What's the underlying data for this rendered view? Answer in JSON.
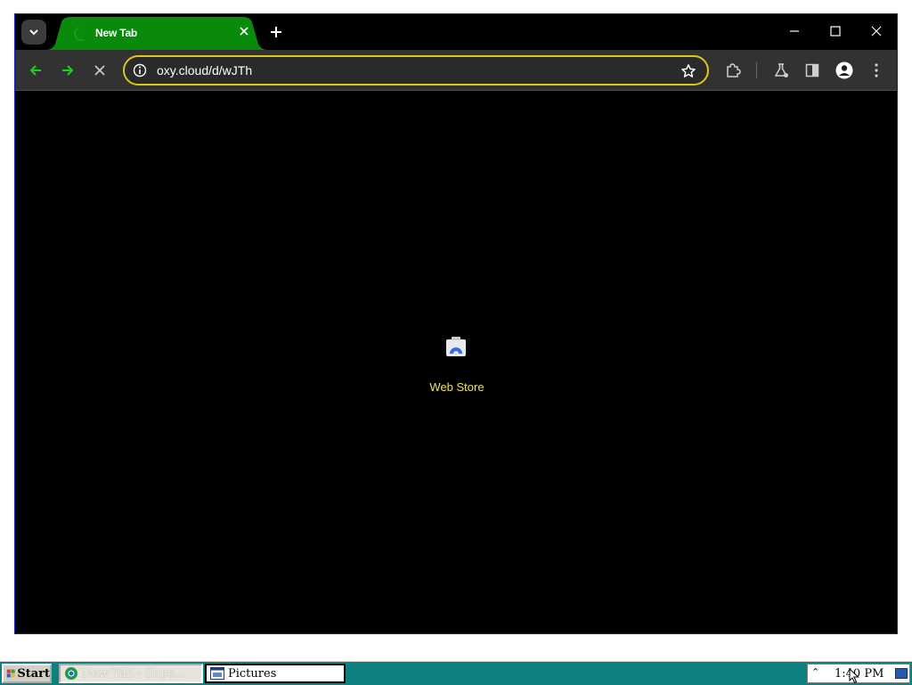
{
  "browser": {
    "tab": {
      "title": "New Tab",
      "loading": true
    },
    "omnibox": {
      "url": "oxy.cloud/d/wJTh"
    },
    "colors": {
      "tab_active": "#0a8a0a",
      "nav_arrow": "#1fcf1f",
      "omnibox_border": "#d9c81a",
      "shortcut_label": "#f0e060"
    }
  },
  "content": {
    "shortcuts": [
      {
        "label": "Web Store",
        "icon": "web-store-icon"
      }
    ]
  },
  "taskbar": {
    "start_label": "Start",
    "tasks": [
      {
        "label": "New Tab - Supe...",
        "icon": "chrome-icon",
        "active": true
      },
      {
        "label": "Pictures",
        "icon": "folder-window-icon",
        "active": false
      }
    ],
    "clock": "1:40 PM"
  }
}
